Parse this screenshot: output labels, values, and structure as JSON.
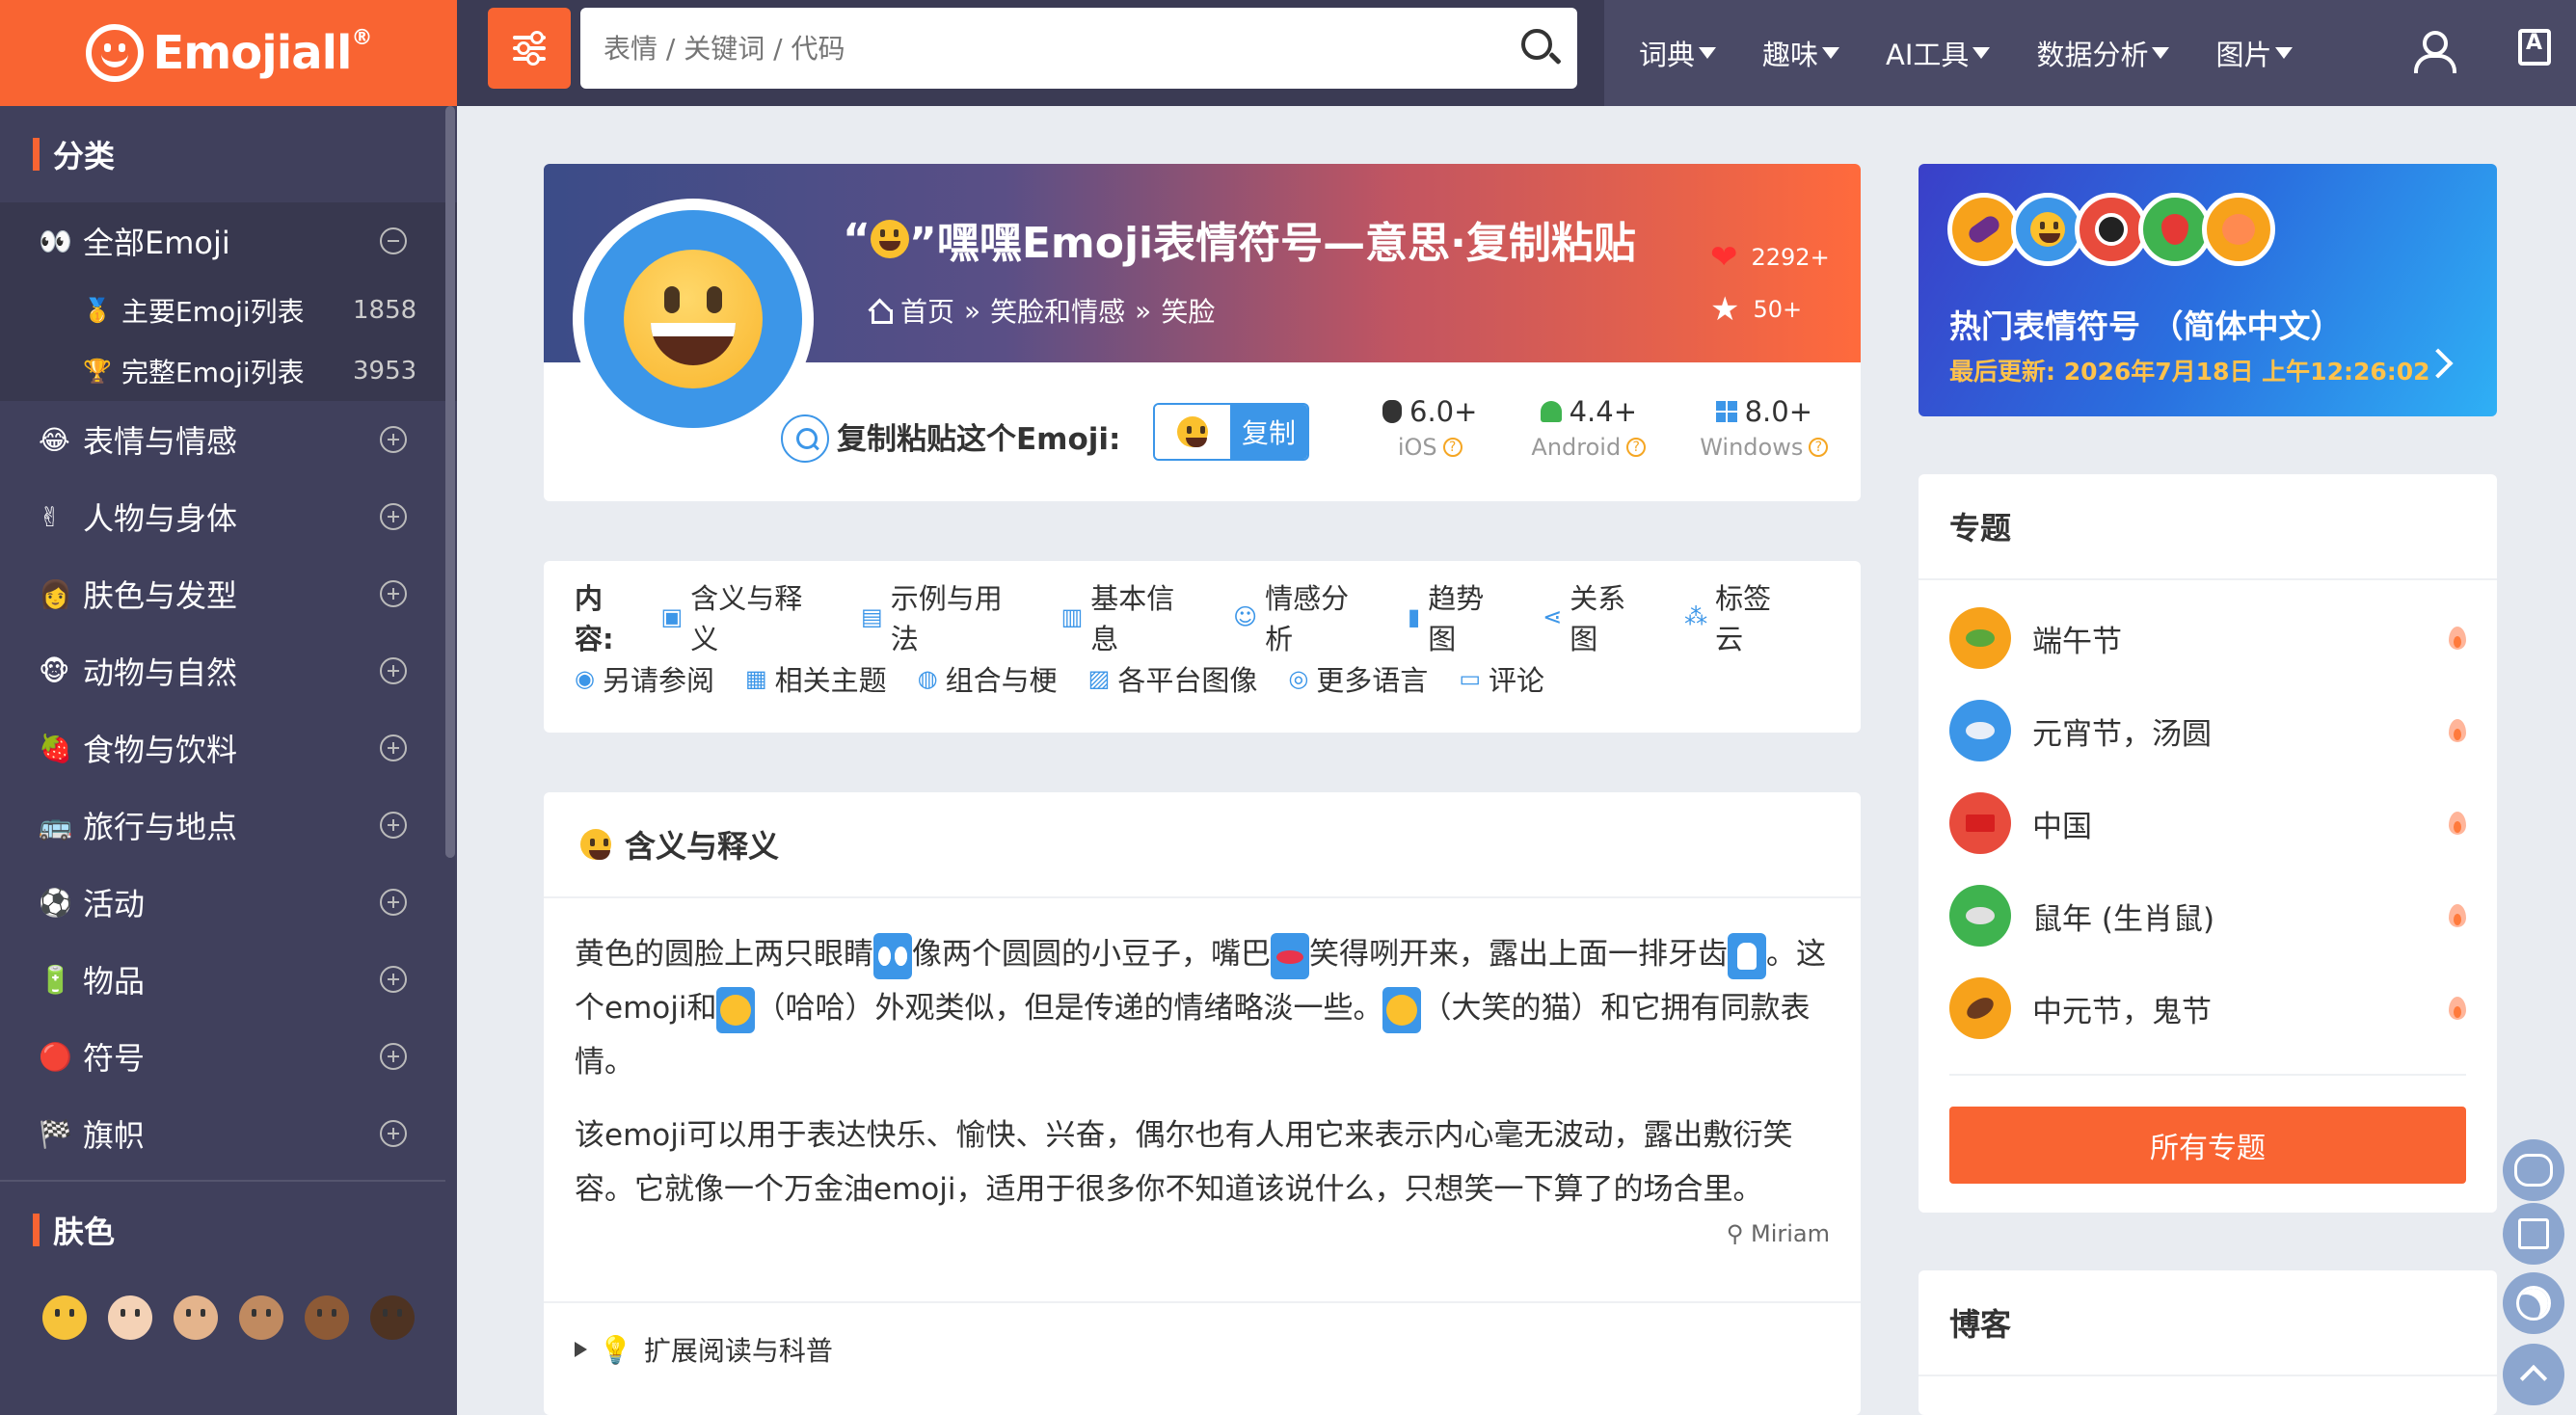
{
  "brand": {
    "name": "Emojiall",
    "mark": "®"
  },
  "search": {
    "placeholder": "表情 / 关键词 / 代码"
  },
  "nav": [
    "词典",
    "趣味",
    "AI工具",
    "数据分析",
    "图片"
  ],
  "sidebar": {
    "categories_title": "分类",
    "all": "全部Emoji",
    "sub": [
      {
        "label": "主要Emoji列表",
        "count": "1858",
        "icon": "medal-icon"
      },
      {
        "label": "完整Emoji列表",
        "count": "3953",
        "icon": "trophy-icon"
      }
    ],
    "cats": [
      {
        "label": "表情与情感",
        "icon": "laughing-face-icon"
      },
      {
        "label": "人物与身体",
        "icon": "victory-hand-icon"
      },
      {
        "label": "肤色与发型",
        "icon": "red-hair-person-icon"
      },
      {
        "label": "动物与自然",
        "icon": "monkey-icon"
      },
      {
        "label": "食物与饮料",
        "icon": "strawberry-icon"
      },
      {
        "label": "旅行与地点",
        "icon": "bus-icon"
      },
      {
        "label": "活动",
        "icon": "soccer-ball-icon"
      },
      {
        "label": "物品",
        "icon": "battery-icon"
      },
      {
        "label": "符号",
        "icon": "red-circle-icon"
      },
      {
        "label": "旗帜",
        "icon": "checkered-flag-icon"
      }
    ],
    "skin_title": "肤色",
    "tones": [
      "#f6c33a",
      "#f4d2b6",
      "#e4b48c",
      "#c08a60",
      "#8d5a36",
      "#4e3322"
    ]
  },
  "hero": {
    "title_prefix": "“",
    "title_rest": "”嘿嘿Emoji表情符号—意思·复制粘贴",
    "breadcrumb": [
      "首页",
      "»",
      "笑脸和情感",
      "»",
      "笑脸"
    ],
    "likes": "2292+",
    "stars": "50+",
    "copy_label": "复制粘贴这个Emoji:",
    "copy_button": "复制",
    "platforms": [
      {
        "ver": "6.0+",
        "name": "iOS"
      },
      {
        "ver": "4.4+",
        "name": "Android"
      },
      {
        "ver": "8.0+",
        "name": "Windows"
      }
    ]
  },
  "toc": {
    "label": "内容:",
    "row1": [
      "含义与释义",
      "示例与用法",
      "基本信息",
      "情感分析",
      "趋势图",
      "关系图",
      "标签云"
    ],
    "row2": [
      "另请参阅",
      "相关主题",
      "组合与梗",
      "各平台图像",
      "更多语言",
      "评论"
    ]
  },
  "meaning": {
    "title": "含义与释义",
    "p1_a": "黄色的圆脸上两只眼睛",
    "p1_b": "像两个圆圆的小豆子，嘴巴",
    "p1_c": "笑得咧开来，露出上面一排牙齿",
    "p1_d": "。这个emoji和",
    "p1_e": "（哈哈）外观类似，但是传递的情绪略淡一些。",
    "p1_f": "（大笑的猫）和它拥有同款表情。",
    "p2": "该emoji可以用于表达快乐、愉快、兴奋，偶尔也有人用它来表示内心毫无波动，露出敷衍笑容。它就像一个万金油emoji，适用于很多你不知道该说什么，只想笑一下算了的场合里。",
    "author": "Miriam",
    "expand": "扩展阅读与科普"
  },
  "trending": {
    "title": "热门表情符号 （简体中文）",
    "updated": "最后更新: 2026年7月18日 上午12:26:02"
  },
  "topics": {
    "title": "专题",
    "items": [
      {
        "label": "端午节",
        "bg": "#f7a21b",
        "ico": "#5aa83c"
      },
      {
        "label": "元宵节，汤圆",
        "bg": "#3c96e8",
        "ico": "#e8eef8"
      },
      {
        "label": "中国",
        "bg": "#e84b3c",
        "ico": "#d61f1f"
      },
      {
        "label": "鼠年 (生肖鼠)",
        "bg": "#3fb34f",
        "ico": "#e0e0e0"
      },
      {
        "label": "中元节，鬼节",
        "bg": "#f7a21b",
        "ico": "#6b3a1e"
      }
    ],
    "all_button": "所有专题"
  },
  "blog": {
    "title": "博客"
  }
}
